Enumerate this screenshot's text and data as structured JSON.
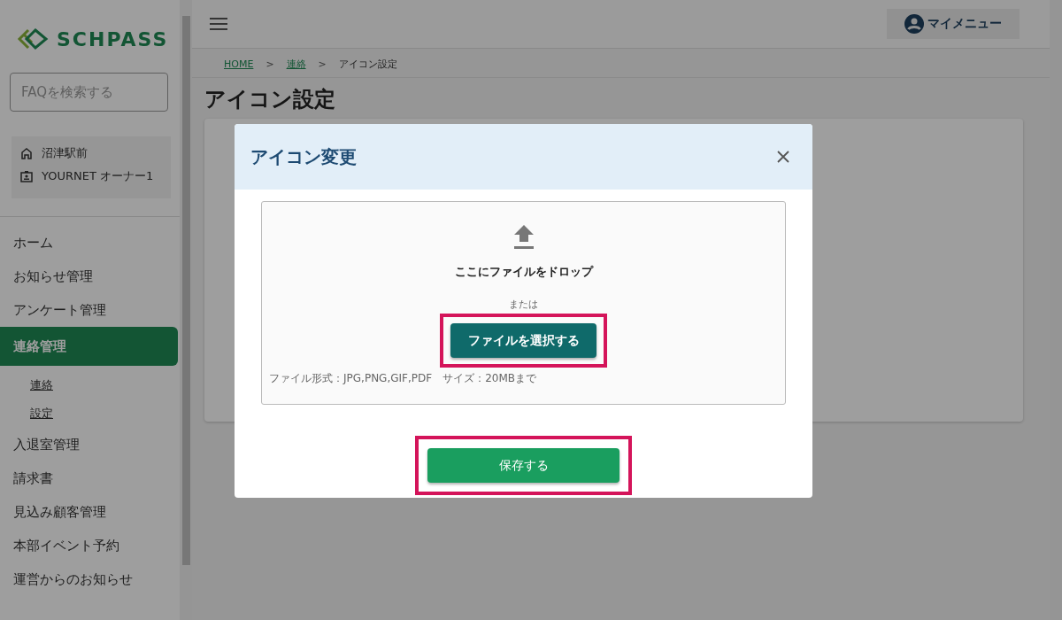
{
  "sidebar": {
    "logo": "SCHPASS",
    "search": {
      "placeholder": "FAQを検索する"
    },
    "account": {
      "school": "沼津駅前",
      "user": "YOURNET オーナー1"
    },
    "nav": [
      {
        "label": "ホーム",
        "selected": false
      },
      {
        "label": "お知らせ管理",
        "selected": false
      },
      {
        "label": "アンケート管理",
        "selected": false
      },
      {
        "label": "連絡管理",
        "selected": true,
        "children": [
          {
            "label": "連絡"
          },
          {
            "label": "設定"
          }
        ]
      },
      {
        "label": "入退室管理",
        "selected": false
      },
      {
        "label": "請求書",
        "selected": false
      },
      {
        "label": "見込み顧客管理",
        "selected": false
      },
      {
        "label": "本部イベント予約",
        "selected": false
      },
      {
        "label": "運営からのお知らせ",
        "selected": false
      }
    ]
  },
  "header": {
    "my_menu": "マイメニュー"
  },
  "breadcrumb": [
    {
      "label": "HOME",
      "link": true
    },
    {
      "label": "連絡",
      "link": true
    },
    {
      "label": "アイコン設定",
      "link": false
    }
  ],
  "breadcrumb_separator": ">",
  "page_title": "アイコン設定",
  "dialog": {
    "title": "アイコン変更",
    "drop_text": "ここにファイルをドロップ",
    "or_text": "または",
    "select_button": "ファイルを選択する",
    "file_note": "ファイル形式：JPG,PNG,GIF,PDF　サイズ：20MBまで",
    "save_button": "保存する"
  }
}
